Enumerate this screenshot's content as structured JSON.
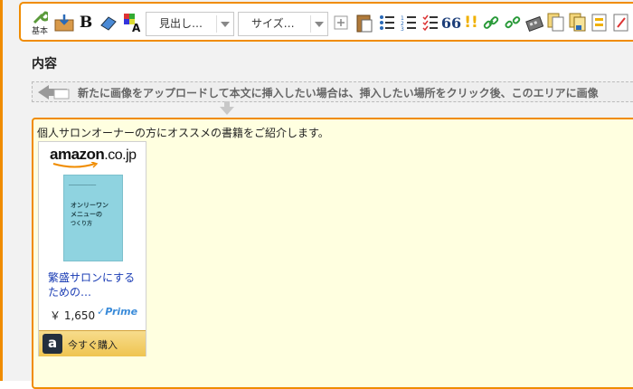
{
  "toolbar": {
    "basic_label": "基本",
    "bold_label": "B",
    "heading_select": "見出し…",
    "size_select": "サイズ…",
    "quote_glyph": "66",
    "exclaim_glyph": "!!"
  },
  "section": {
    "title": "内容"
  },
  "upload": {
    "text": "新たに画像をアップロードして本文に挿入したい場合は、挿入したい場所をクリック後、このエリアに画像"
  },
  "editor": {
    "intro": "個人サロンオーナーの方にオススメの書籍をご紹介します。"
  },
  "product": {
    "store_logo": "amazon",
    "store_logo_suffix": ".co.jp",
    "cover_lines": [
      "オンリーワン",
      "メニューの",
      "つくり方"
    ],
    "title": "繁盛サロンにするための…",
    "price": "￥ 1,650",
    "prime": "✓Prime",
    "buy_label": "今すぐ購入",
    "buy_icon": "a"
  },
  "colors": {
    "accent": "#f08c00",
    "editor_bg": "#ffffe0",
    "link": "#1a3cb4"
  }
}
